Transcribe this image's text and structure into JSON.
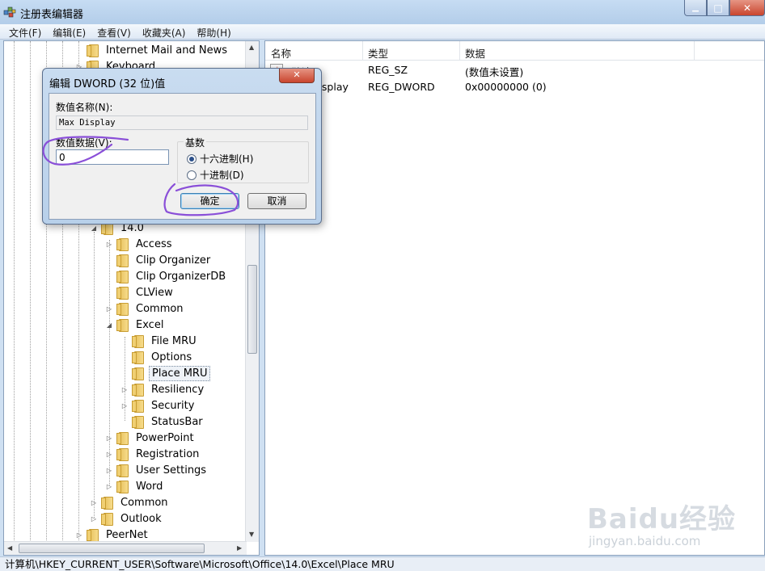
{
  "window": {
    "title": "注册表编辑器",
    "min_glyph": "▁",
    "max_glyph": "□",
    "close_glyph": "✕"
  },
  "menu": [
    "文件(F)",
    "编辑(E)",
    "查看(V)",
    "收藏夹(A)",
    "帮助(H)"
  ],
  "tree": {
    "items": [
      {
        "label": "Internet Mail and News",
        "expander": "",
        "selected": false
      },
      {
        "label": "Keyboard",
        "expander": "▷",
        "selected": false
      },
      {
        "label": "14.0",
        "expander": "◢",
        "selected": false
      },
      {
        "label": "Access",
        "expander": "▷",
        "selected": false
      },
      {
        "label": "Clip Organizer",
        "expander": "",
        "selected": false
      },
      {
        "label": "Clip OrganizerDB",
        "expander": "",
        "selected": false
      },
      {
        "label": "CLView",
        "expander": "",
        "selected": false
      },
      {
        "label": "Common",
        "expander": "▷",
        "selected": false
      },
      {
        "label": "Excel",
        "expander": "◢",
        "selected": false
      },
      {
        "label": "File MRU",
        "expander": "",
        "selected": false
      },
      {
        "label": "Options",
        "expander": "",
        "selected": false
      },
      {
        "label": "Place MRU",
        "expander": "",
        "selected": true
      },
      {
        "label": "Resiliency",
        "expander": "▷",
        "selected": false
      },
      {
        "label": "Security",
        "expander": "▷",
        "selected": false
      },
      {
        "label": "StatusBar",
        "expander": "",
        "selected": false
      },
      {
        "label": "PowerPoint",
        "expander": "▷",
        "selected": false
      },
      {
        "label": "Registration",
        "expander": "▷",
        "selected": false
      },
      {
        "label": "User Settings",
        "expander": "▷",
        "selected": false
      },
      {
        "label": "Word",
        "expander": "▷",
        "selected": false
      },
      {
        "label": "Common",
        "expander": "▷",
        "selected": false
      },
      {
        "label": "Outlook",
        "expander": "▷",
        "selected": false
      },
      {
        "label": "PeerNet",
        "expander": "▷",
        "selected": false
      }
    ]
  },
  "list": {
    "columns": [
      "名称",
      "类型",
      "数据"
    ],
    "rows": [
      {
        "name": "(默认)",
        "type": "REG_SZ",
        "data": "(数值未设置)",
        "icon": "ab"
      },
      {
        "name": "Max Display",
        "type": "REG_DWORD",
        "data": "0x00000000 (0)",
        "icon": "011"
      }
    ]
  },
  "status": "计算机\\HKEY_CURRENT_USER\\Software\\Microsoft\\Office\\14.0\\Excel\\Place MRU",
  "dialog": {
    "title": "编辑 DWORD (32 位)值",
    "close_glyph": "✕",
    "value_name_label": "数值名称(N):",
    "value_name": "Max Display",
    "value_data_label": "数值数据(V):",
    "value_data": "0",
    "base_label": "基数",
    "radio_hex": "十六进制(H)",
    "radio_dec": "十进制(D)",
    "hex_selected": true,
    "ok": "确定",
    "cancel": "取消"
  },
  "watermark": {
    "big": "Baidu经验",
    "small": "jingyan.baidu.com"
  },
  "colors": {
    "annotation": "#8a4fd8",
    "selection_border": "#7a8b9f",
    "close_red": "#c9452e"
  }
}
